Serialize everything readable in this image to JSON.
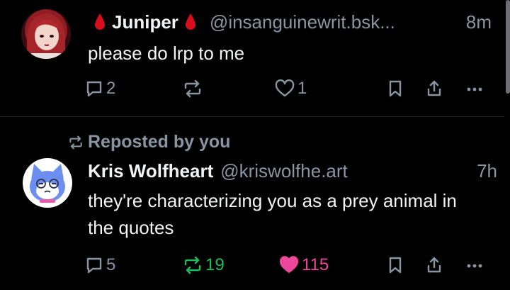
{
  "posts": [
    {
      "author_name": "Juniper",
      "author_handle": "@insanguinewrit.bsk...",
      "time": "8m",
      "text": "please do lrp to me",
      "reply_count": "2",
      "repost_count": "",
      "like_count": "1",
      "liked": false,
      "reposted": false
    },
    {
      "repost_label": "Reposted by you",
      "author_name": "Kris Wolfheart",
      "author_handle": "@kriswolfhe.art",
      "time": "7h",
      "text": "they're characterizing you as a prey animal in the quotes",
      "reply_count": "5",
      "repost_count": "19",
      "like_count": "115",
      "liked": true,
      "reposted": true
    }
  ],
  "colors": {
    "background": "#000000",
    "text": "#f1f3f5",
    "muted": "#8a95a3",
    "repost_active": "#20bc5c",
    "like_active": "#ec4899",
    "drop": "#d60f1c"
  },
  "icons": [
    "blood-drop-icon",
    "reply-icon",
    "repost-icon",
    "heart-icon",
    "bookmark-icon",
    "share-icon",
    "more-icon"
  ]
}
